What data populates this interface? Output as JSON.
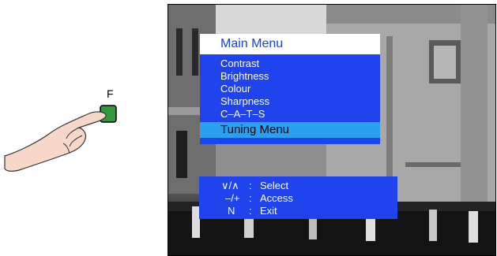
{
  "remote": {
    "key_label": "F"
  },
  "osd": {
    "title": "Main Menu",
    "items": [
      {
        "label": "Contrast"
      },
      {
        "label": "Brightness"
      },
      {
        "label": "Colour"
      },
      {
        "label": "Sharpness"
      },
      {
        "label": "C–A–T–S"
      },
      {
        "label": "Tuning Menu",
        "selected": true
      }
    ],
    "hints": [
      {
        "key": "∨/∧",
        "sep": ":",
        "action": "Select"
      },
      {
        "key": "–/+",
        "sep": ":",
        "action": "Access"
      },
      {
        "key": "N",
        "sep": ":",
        "action": "Exit"
      }
    ]
  },
  "colors": {
    "menu_blue": "#1f44ee",
    "selected_blue": "#2aa0f0",
    "title_text": "#1a3fe0",
    "key_green": "#2f9a3a"
  }
}
